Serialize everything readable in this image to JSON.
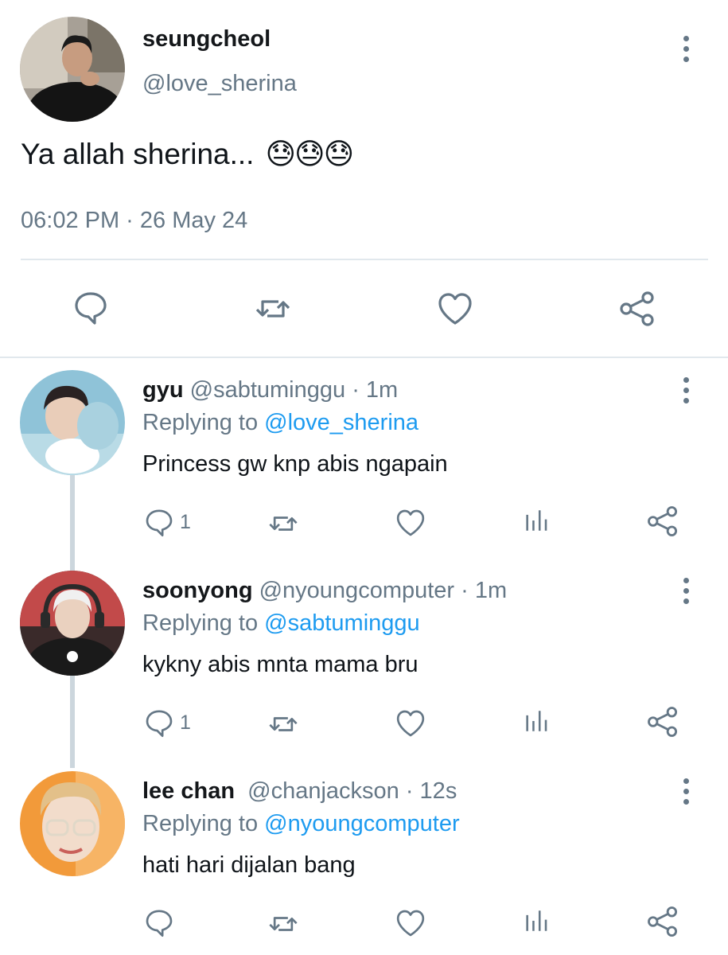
{
  "main_tweet": {
    "display_name": "seungcheol",
    "handle": "@love_sherina",
    "text": "Ya allah sherina...",
    "emoji": "😓😓😓",
    "timestamp": "06:02 PM · 26 May 24",
    "actions": [
      "reply",
      "retweet",
      "like",
      "share"
    ]
  },
  "replies": [
    {
      "display_name": "gyu",
      "handle": "@sabtuminggu",
      "time": "· 1m",
      "replying_label": "Replying to",
      "replying_to": "@love_sherina",
      "text": "Princess gw knp abis ngapain",
      "reply_count": "1"
    },
    {
      "display_name": "soonyong",
      "handle": "@nyoungcomputer",
      "time": "· 1m",
      "replying_label": "Replying to",
      "replying_to": "@sabtuminggu",
      "text": "kykny abis mnta mama bru",
      "reply_count": "1"
    },
    {
      "display_name": "lee chan",
      "handle": "@chanjackson",
      "time": "· 12s",
      "replying_label": "Replying to",
      "replying_to": "@nyoungcomputer",
      "text": "hati hari dijalan bang",
      "reply_count": ""
    }
  ],
  "colors": {
    "accent": "#1d9bf0",
    "secondary_text": "#657786",
    "divider": "#e1e8ed"
  }
}
